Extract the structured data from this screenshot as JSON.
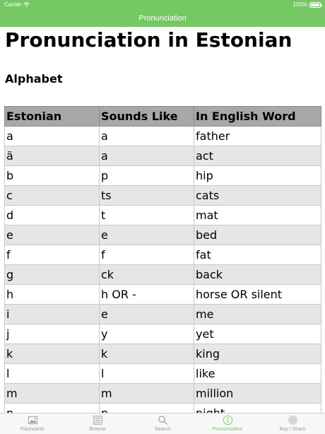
{
  "status_bar": {
    "carrier": "Carrier",
    "battery": "100%"
  },
  "nav": {
    "title": "Pronunciation"
  },
  "page": {
    "title": "Pronunciation in Estonian",
    "section": "Alphabet"
  },
  "table": {
    "headers": [
      "Estonian",
      "Sounds Like",
      "In English Word"
    ],
    "rows": [
      [
        "a",
        "a",
        "father"
      ],
      [
        "ä",
        "a",
        "act"
      ],
      [
        "b",
        "p",
        "hip"
      ],
      [
        "c",
        "ts",
        "cats"
      ],
      [
        "d",
        "t",
        "mat"
      ],
      [
        "e",
        "e",
        "bed"
      ],
      [
        "f",
        "f",
        "fat"
      ],
      [
        "g",
        "ck",
        "back"
      ],
      [
        "h",
        "h OR -",
        "horse OR silent"
      ],
      [
        "i",
        "e",
        "me"
      ],
      [
        "j",
        "y",
        "yet"
      ],
      [
        "k",
        "k",
        "king"
      ],
      [
        "l",
        "l",
        "like"
      ],
      [
        "m",
        "m",
        "million"
      ],
      [
        "n",
        "n",
        "night"
      ]
    ]
  },
  "tabs": [
    {
      "label": "Flashcards",
      "icon": "image-icon"
    },
    {
      "label": "Browse",
      "icon": "list-icon"
    },
    {
      "label": "Search",
      "icon": "search-icon"
    },
    {
      "label": "Pronunciation",
      "icon": "info-icon",
      "active": true
    },
    {
      "label": "Buy / Share",
      "icon": "gear-icon"
    }
  ],
  "colors": {
    "accent": "#76c865",
    "header_bg": "#a8a8a8",
    "row_alt": "#e6e6e6"
  }
}
